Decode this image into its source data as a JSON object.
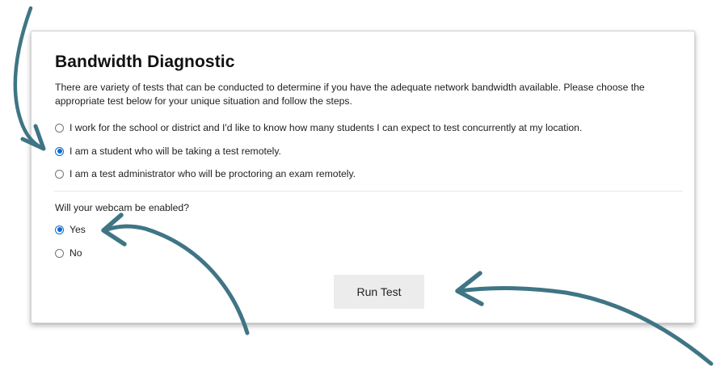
{
  "panel": {
    "title": "Bandwidth Diagnostic",
    "description": "There are variety of tests that can be conducted to determine if you have the adequate network bandwidth available. Please choose the appropriate test below for your unique situation and follow the steps."
  },
  "role_options": [
    {
      "label": "I work for the school or district and I'd like to know how many students I can expect to test concurrently at my location.",
      "checked": false
    },
    {
      "label": "I am a student who will be taking a test remotely.",
      "checked": true
    },
    {
      "label": "I am a test administrator who will be proctoring an exam remotely.",
      "checked": false
    }
  ],
  "webcam": {
    "question": "Will your webcam be enabled?",
    "options": [
      {
        "label": "Yes",
        "checked": true
      },
      {
        "label": "No",
        "checked": false
      }
    ]
  },
  "run_button_label": "Run Test",
  "colors": {
    "radio_accent": "#0b6bd8",
    "annotation_arrow": "#3f7585",
    "button_bg": "#ececec"
  }
}
